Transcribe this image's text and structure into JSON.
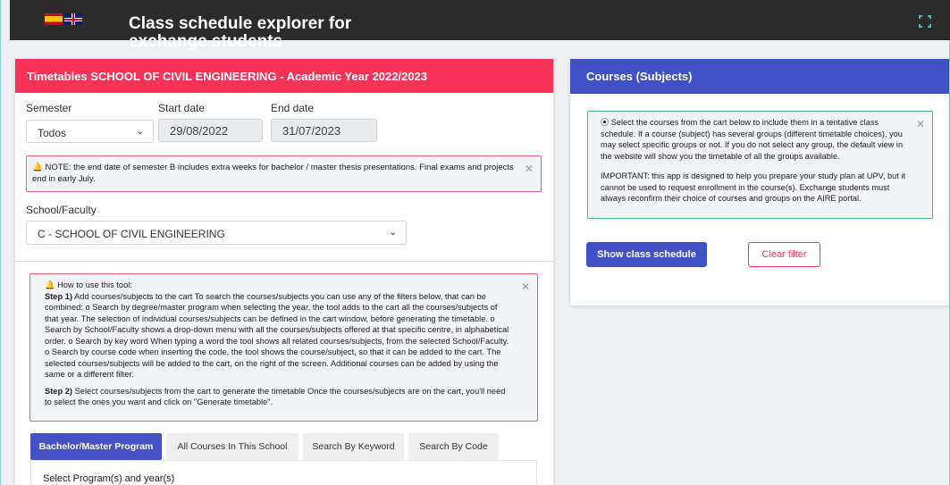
{
  "header": {
    "title": "Class schedule explorer for exchange students",
    "flags": [
      "spain-flag",
      "uk-flag"
    ]
  },
  "left": {
    "title": "Timetables SCHOOL OF CIVIL ENGINEERING - Academic Year 2022/2023",
    "semester_label": "Semester",
    "semester_value": "Todos",
    "start_label": "Start date",
    "start_value": "29/08/2022",
    "end_label": "End date",
    "end_value": "31/07/2023",
    "note": "NOTE: the end date of semester B includes extra weeks for bachelor / master thesis presentations. Final exams and projects end in early July.",
    "school_label": "School/Faculty",
    "school_value": "C - SCHOOL OF CIVIL ENGINEERING",
    "howto_title": "How to use this tool:",
    "step1_label": "Step 1)",
    "step1_text": "Add courses/subjects to the cart To search the courses/subjects you can use any of the filters below, that can be combined: o Search by degree/master program when selecting the year, the tool adds to the cart all the courses/subjects of that year. The selection of individual courses/subjects can be defined in the cart window, before generating the timetable. o Search by School/Faculty shows a drop-down menu with all the courses/subjects offered at that specific centre, in alphabetical order. o Search by key word When typing a word the tool shows all related courses/subjects, from the selected School/Faculty. o Search by course code when inserting the code, the tool shows the course/subject, so that it can be added to the cart. The selected courses/subjects will be added to the cart, on the right of the screen. Additional courses can be added by using the same or a different filter.",
    "step2_label": "Step 2)",
    "step2_text": "Select courses/subjects from the cart to generate the timetable Once the courses/subjects are on the cart, you'll need to select the ones you want and click on \"Generate timetable\".",
    "tabs": [
      "Bachelor/Master Program",
      "All Courses In This School",
      "Search By Keyword",
      "Search By Code"
    ],
    "program_label": "Select Program(s) and year(s)"
  },
  "right": {
    "title": "Courses (Subjects)",
    "info_p1": "Select the courses from the cart below to include them in a tentative class schedule. If a course (subject) has several groups (different timetable choices), you may select specific groups or not. If you do not select any group, the default view in the website will show you the timetable of all the groups available.",
    "info_p2": "IMPORTANT: this app is designed to help you prepare your study plan at UPV, but it cannot be used to request enrollment in the course(s). Exchange students must always reconfirm their choice of courses and groups on the AIRE portal.",
    "show_button": "Show class schedule",
    "clear_button": "Clear filter"
  },
  "colors": {
    "topbar": "#2b2b2b",
    "left_header": "#f7335a",
    "right_header": "#3f51c5",
    "active_tab": "#4450c4"
  }
}
